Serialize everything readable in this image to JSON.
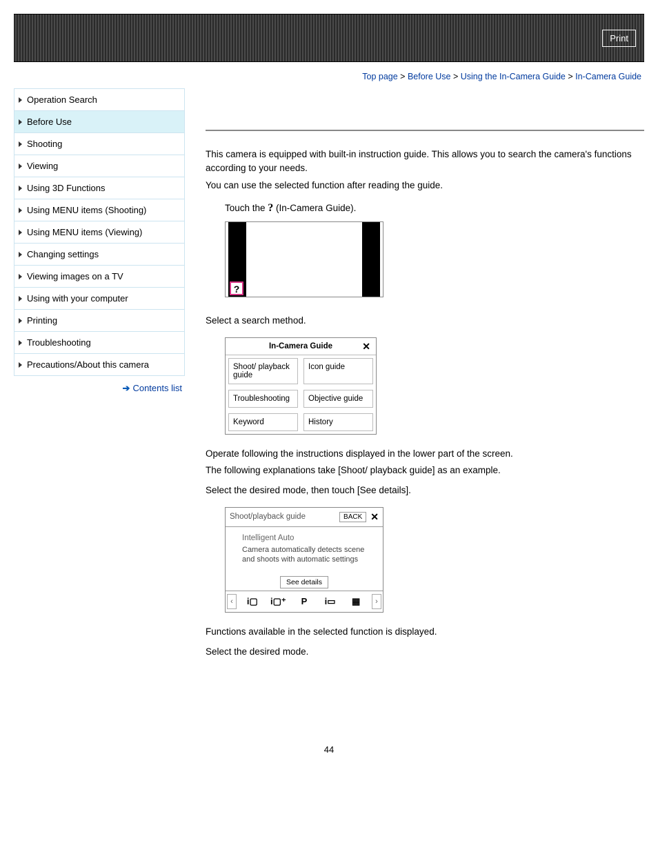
{
  "header": {
    "print": "Print"
  },
  "breadcrumb": {
    "sep": " > ",
    "top": "Top page",
    "b1": "Before Use",
    "b2": "Using the In-Camera Guide",
    "last": "In-Camera Guide"
  },
  "sidebar": {
    "items": [
      "Operation Search",
      "Before Use",
      "Shooting",
      "Viewing",
      "Using 3D Functions",
      "Using MENU items (Shooting)",
      "Using MENU items (Viewing)",
      "Changing settings",
      "Viewing images on a TV",
      "Using with your computer",
      "Printing",
      "Troubleshooting",
      "Precautions/About this camera"
    ],
    "active_index": 1,
    "contents_link": "Contents list"
  },
  "main": {
    "intro1": "This camera is equipped with built-in instruction guide. This allows you to search the camera's functions according to your needs.",
    "intro2": "You can use the selected function after reading the guide.",
    "step1_pre": "Touch the ",
    "step1_q": "?",
    "step1_post": " (In-Camera Guide).",
    "step2": "Select a search method.",
    "guide_menu": {
      "title": "In-Camera Guide",
      "close": "✕",
      "cells": [
        "Shoot/ playback guide",
        "Icon guide",
        "Troubleshooting",
        "Objective guide",
        "Keyword",
        "History"
      ]
    },
    "op1": "Operate following the instructions displayed in the lower part of the screen.",
    "op2": "The following explanations take [Shoot/ playback guide] as an example.",
    "step3": "Select the desired mode, then touch [See details].",
    "shoot_guide": {
      "title": "Shoot/playback guide",
      "back": "BACK",
      "close": "✕",
      "mode": "Intelligent Auto",
      "desc": "Camera automatically detects scene and shoots with automatic settings",
      "see": "See details",
      "strip": [
        "i▢",
        "i▢⁺",
        "P",
        "i▭",
        "▦"
      ]
    },
    "after1": "Functions available in the selected function is displayed.",
    "after2": "Select the desired mode.",
    "page_num": "44"
  }
}
